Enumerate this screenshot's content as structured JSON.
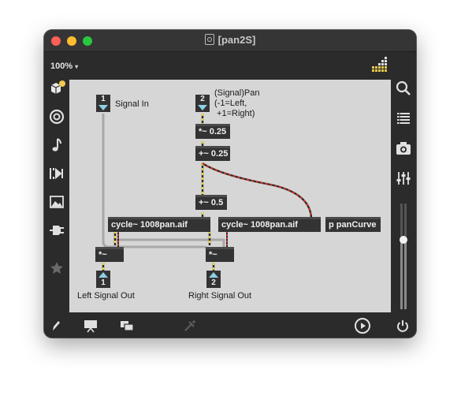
{
  "window": {
    "title": "[pan2S]",
    "zoom": "100%",
    "zoom_caret": "▾"
  },
  "icons": {
    "left": [
      "package-icon",
      "target-icon",
      "music-note-icon",
      "step-icon",
      "image-icon",
      "plug-icon",
      "star-icon"
    ],
    "right": [
      "search-icon",
      "list-icon",
      "camera-icon",
      "mixer-icon",
      "volume-slider"
    ],
    "bottom": [
      "pencil-icon",
      "presentation-icon",
      "windows-icon",
      "debug-icon",
      "play-icon",
      "power-icon"
    ]
  },
  "patch": {
    "inlet1": {
      "number": "1",
      "label": "Signal In"
    },
    "inlet2": {
      "number": "2",
      "label": "(Signal)Pan\n(-1=Left,\n +1=Right)"
    },
    "obj_mul": "*~ 0.25",
    "obj_add1": "+~ 0.25",
    "obj_add2": "+~ 0.5",
    "cycle_left": "cycle~ 1008pan.aif",
    "cycle_right": "cycle~ 1008pan.aif",
    "pan_curve": "p panCurve",
    "mult_left": "*~",
    "mult_right": "*~",
    "outlet1": {
      "number": "1",
      "label": "Left Signal Out"
    },
    "outlet2": {
      "number": "2",
      "label": "Right Signal Out"
    }
  },
  "colors": {
    "canvas": "#d6d6d6",
    "object": "#333333",
    "patch_cord": "#b0b0b0",
    "signal_cord_yellow": "#e6d33c",
    "signal_cord_red": "#c0392b",
    "port_triangle": "#8ecfe6"
  }
}
